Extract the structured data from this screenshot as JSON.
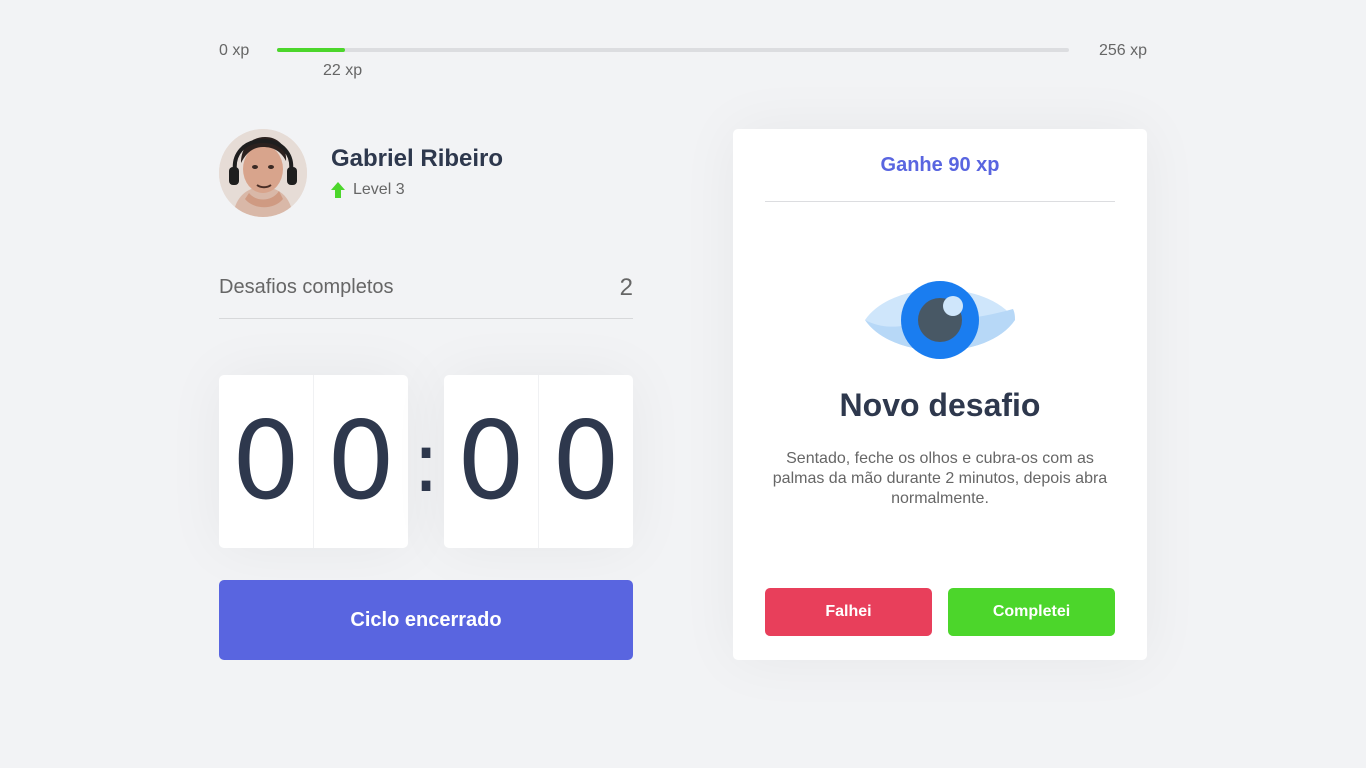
{
  "experience": {
    "min_label": "0 xp",
    "max_label": "256 xp",
    "current_label": "22 xp",
    "current_xp": 22,
    "max_xp": 256,
    "fill_color": "#4cd62b"
  },
  "profile": {
    "name": "Gabriel Ribeiro",
    "level_label": "Level 3",
    "level_icon": "level-up-arrow-icon",
    "level_icon_color": "#4cd62b"
  },
  "completed_challenges": {
    "label": "Desafios completos",
    "count": "2"
  },
  "countdown": {
    "minute_left": "0",
    "minute_right": "0",
    "separator": ":",
    "second_left": "0",
    "second_right": "0"
  },
  "cycle_button": {
    "label": "Ciclo encerrado",
    "color": "#5965e0"
  },
  "challenge": {
    "header": "Ganhe 90 xp",
    "icon": "eye-icon",
    "title": "Novo desafio",
    "description": "Sentado, feche os olhos e cubra-os com as palmas da mão durante 2 minutos, depois abra normalmente.",
    "failed_label": "Falhei",
    "succeeded_label": "Completei",
    "failed_color": "#e83f5b",
    "succeeded_color": "#4cd62b",
    "header_color": "#5965e0"
  }
}
